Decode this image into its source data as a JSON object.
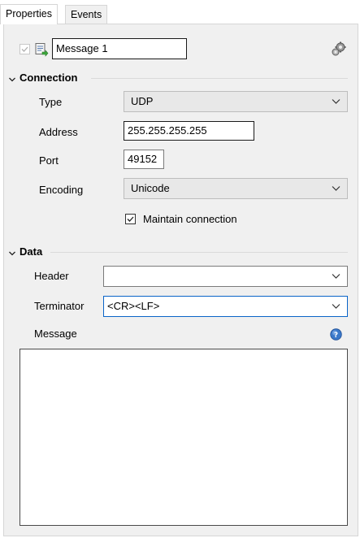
{
  "tabs": [
    {
      "label": "Properties",
      "active": true
    },
    {
      "label": "Events",
      "active": false
    }
  ],
  "header": {
    "enabled_checked": true,
    "message_name": "Message 1",
    "icons": [
      "message-send-icon",
      "gears-icon"
    ]
  },
  "connection": {
    "section_label": "Connection",
    "type_label": "Type",
    "type_value": "UDP",
    "address_label": "Address",
    "address_value": "255.255.255.255",
    "port_label": "Port",
    "port_value": "49152",
    "encoding_label": "Encoding",
    "encoding_value": "Unicode",
    "maintain_label": "Maintain connection",
    "maintain_checked": true
  },
  "data": {
    "section_label": "Data",
    "header_label": "Header",
    "header_value": "",
    "terminator_label": "Terminator",
    "terminator_value": "<CR><LF>",
    "message_label": "Message",
    "message_value": ""
  },
  "colors": {
    "panel_bg": "#f0f0f0",
    "combo_bg": "#e8e8e8",
    "focus_border": "#0a64c8",
    "help_icon": "#3a78c9"
  }
}
